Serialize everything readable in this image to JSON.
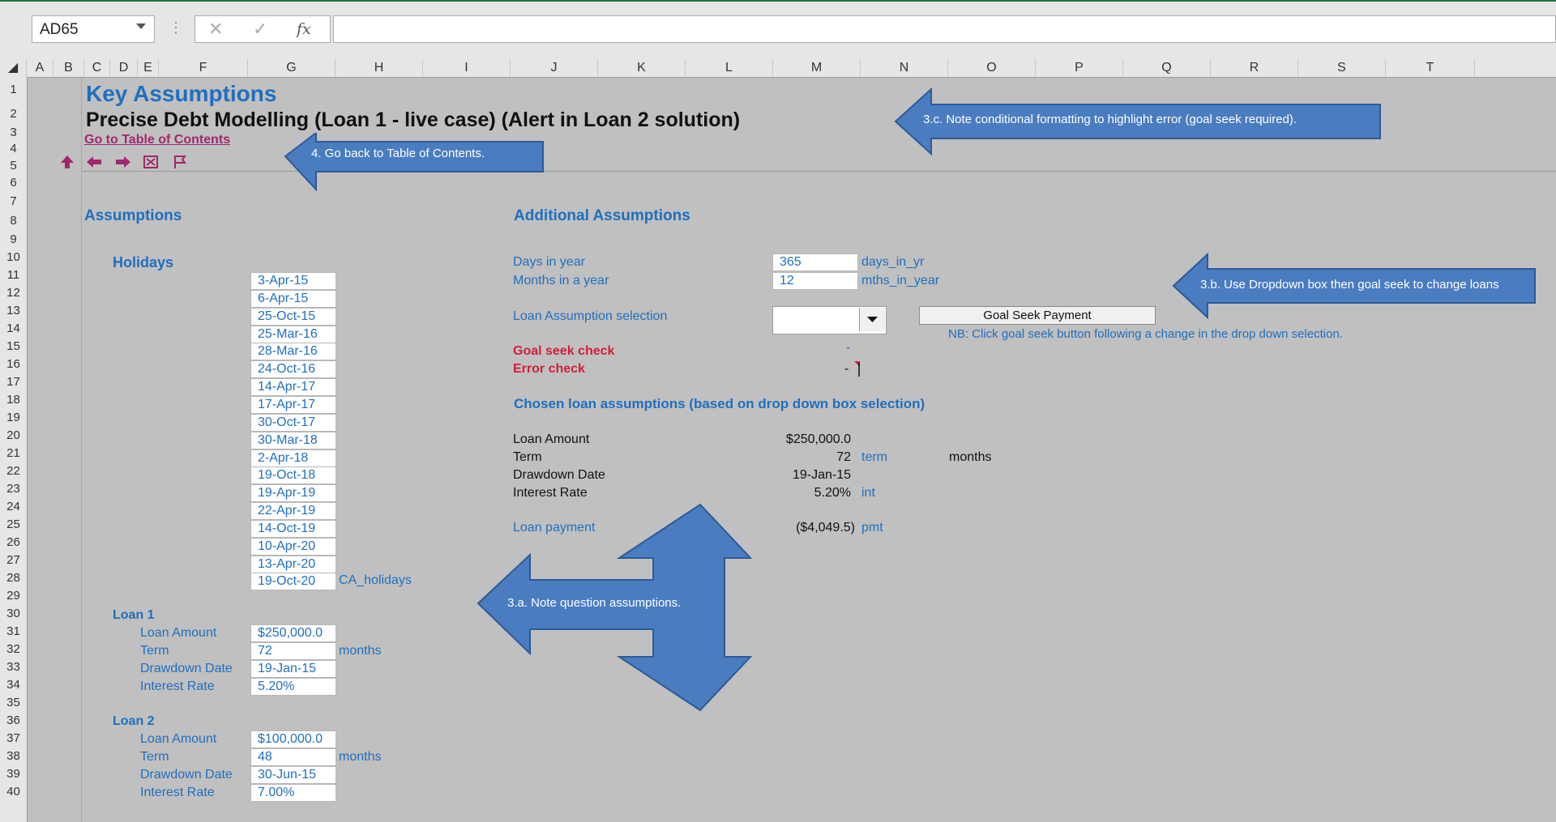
{
  "name_box": "AD65",
  "formula_icons": {
    "cancel": "✕",
    "enter": "✓",
    "fx": "fx"
  },
  "columns": [
    "A",
    "B",
    "C",
    "D",
    "E",
    "F",
    "G",
    "H",
    "I",
    "J",
    "K",
    "L",
    "M",
    "N",
    "O",
    "P",
    "Q",
    "R",
    "S",
    "T"
  ],
  "rows": [
    "1",
    "2",
    "3",
    "4",
    "5",
    "6",
    "7",
    "8",
    "9",
    "10",
    "11",
    "12",
    "13",
    "14",
    "15",
    "16",
    "17",
    "18",
    "19",
    "20",
    "21",
    "22",
    "23",
    "24",
    "25",
    "26",
    "27",
    "28",
    "29",
    "30",
    "31",
    "32",
    "33",
    "34",
    "35",
    "36",
    "37",
    "38",
    "39",
    "40"
  ],
  "title": "Key Assumptions",
  "subtitle": "Precise Debt Modelling (Loan 1 - live case) (Alert in Loan 2 solution)",
  "toc_link": "Go to Table of Contents",
  "nav_icons": [
    "up-arrow-icon",
    "left-arrow-icon",
    "right-arrow-icon",
    "close-box-icon",
    "flag-icon"
  ],
  "assumptions_heading": "Assumptions",
  "holidays_heading": "Holidays",
  "holidays": [
    "3-Apr-15",
    "6-Apr-15",
    "25-Oct-15",
    "25-Mar-16",
    "28-Mar-16",
    "24-Oct-16",
    "14-Apr-17",
    "17-Apr-17",
    "30-Oct-17",
    "30-Mar-18",
    "2-Apr-18",
    "19-Oct-18",
    "19-Apr-19",
    "22-Apr-19",
    "14-Oct-19",
    "10-Apr-20",
    "13-Apr-20",
    "19-Oct-20"
  ],
  "holidays_name": "CA_holidays",
  "loan1": {
    "heading": "Loan 1",
    "amount_label": "Loan Amount",
    "amount": "$250,000.0",
    "term_label": "Term",
    "term": "72",
    "term_unit": "months",
    "date_label": "Drawdown Date",
    "date": "19-Jan-15",
    "rate_label": "Interest Rate",
    "rate": "5.20%"
  },
  "loan2": {
    "heading": "Loan 2",
    "amount_label": "Loan Amount",
    "amount": "$100,000.0",
    "term_label": "Term",
    "term": "48",
    "term_unit": "months",
    "date_label": "Drawdown Date",
    "date": "30-Jun-15",
    "rate_label": "Interest Rate",
    "rate": "7.00%"
  },
  "additional": {
    "heading": "Additional Assumptions",
    "days_label": "Days in year",
    "days": "365",
    "days_name": "days_in_yr",
    "months_label": "Months in a year",
    "months": "12",
    "months_name": "mths_in_year",
    "selection_label": "Loan Assumption selection",
    "goal_seek_button": "Goal Seek Payment",
    "note": "NB: Click goal seek button following a change in the drop down selection.",
    "goal_check_label": "Goal seek check",
    "goal_check_value": "-",
    "error_check_label": "Error check",
    "error_check_value": "-"
  },
  "chosen": {
    "heading": "Chosen loan assumptions (based on drop down box selection)",
    "amount_label": "Loan Amount",
    "amount": "$250,000.0",
    "term_label": "Term",
    "term": "72",
    "term_name": "term",
    "term_unit": "months",
    "date_label": "Drawdown Date",
    "date": "19-Jan-15",
    "rate_label": "Interest Rate",
    "rate": "5.20%",
    "rate_name": "int",
    "payment_label": "Loan payment",
    "payment": "($4,049.5)",
    "payment_name": "pmt"
  },
  "callouts": {
    "c3c": "3.c. Note conditional formatting to highlight error (goal seek required).",
    "c4": "4. Go back to Table of Contents.",
    "c3b": "3.b. Use Dropdown box then goal seek to change loans",
    "c3a": "3.a. Note question assumptions."
  },
  "colors": {
    "callout_fill": "#4a7cc0",
    "callout_stroke": "#2e5a96",
    "link": "#a0286e",
    "accent": "#1f6fbf",
    "alert": "#d0203a"
  }
}
